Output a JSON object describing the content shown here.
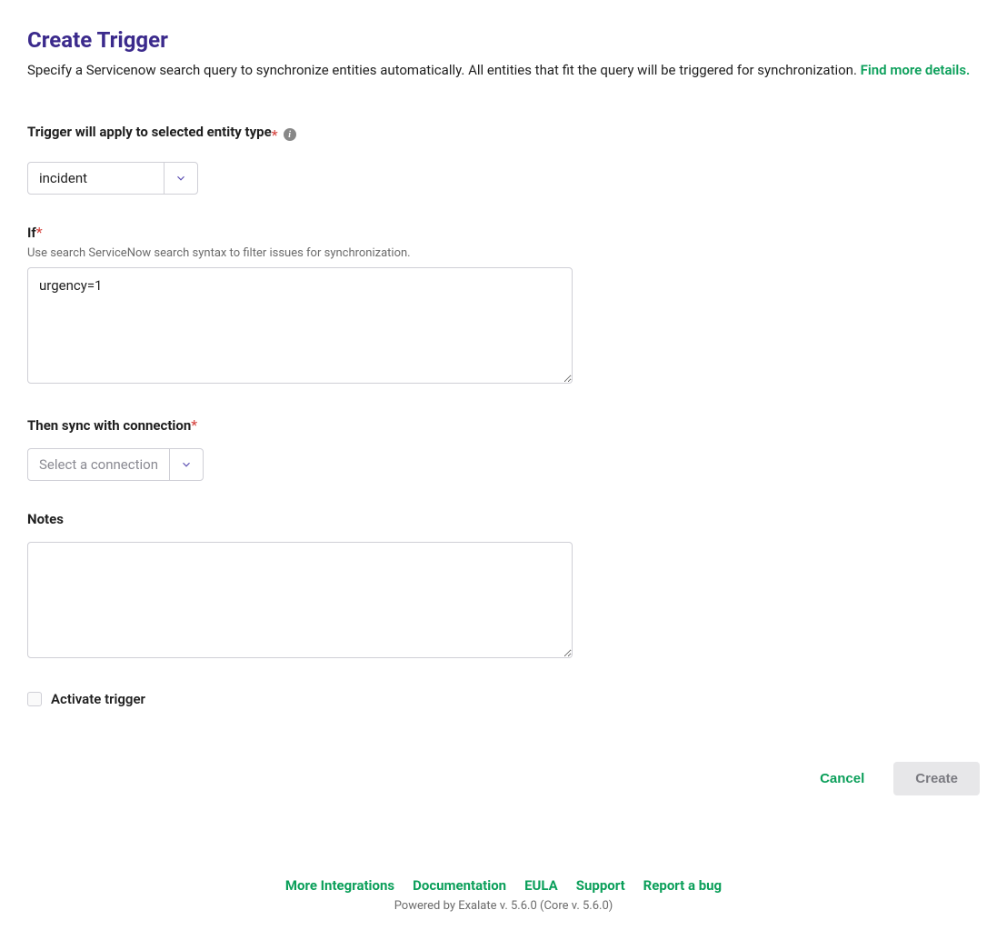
{
  "header": {
    "title": "Create Trigger",
    "description_prefix": "Specify a Servicenow search query to synchronize entities automatically. All entities that fit the query will be triggered for synchronization. ",
    "description_link": "Find more details."
  },
  "form": {
    "entity_type": {
      "label": "Trigger will apply to selected entity type",
      "value": "incident"
    },
    "if_clause": {
      "label": "If",
      "helper": "Use search ServiceNow search syntax to filter issues for synchronization.",
      "value": "urgency=1"
    },
    "connection": {
      "label": "Then sync with connection",
      "placeholder": "Select a connection"
    },
    "notes": {
      "label": "Notes",
      "value": ""
    },
    "activate": {
      "label": "Activate trigger",
      "checked": false
    }
  },
  "actions": {
    "cancel": "Cancel",
    "create": "Create"
  },
  "footer": {
    "links": {
      "more_integrations": "More Integrations",
      "documentation": "Documentation",
      "eula": "EULA",
      "support": "Support",
      "report_bug": "Report a bug"
    },
    "powered": "Powered by Exalate v. 5.6.0 (Core v. 5.6.0)"
  }
}
